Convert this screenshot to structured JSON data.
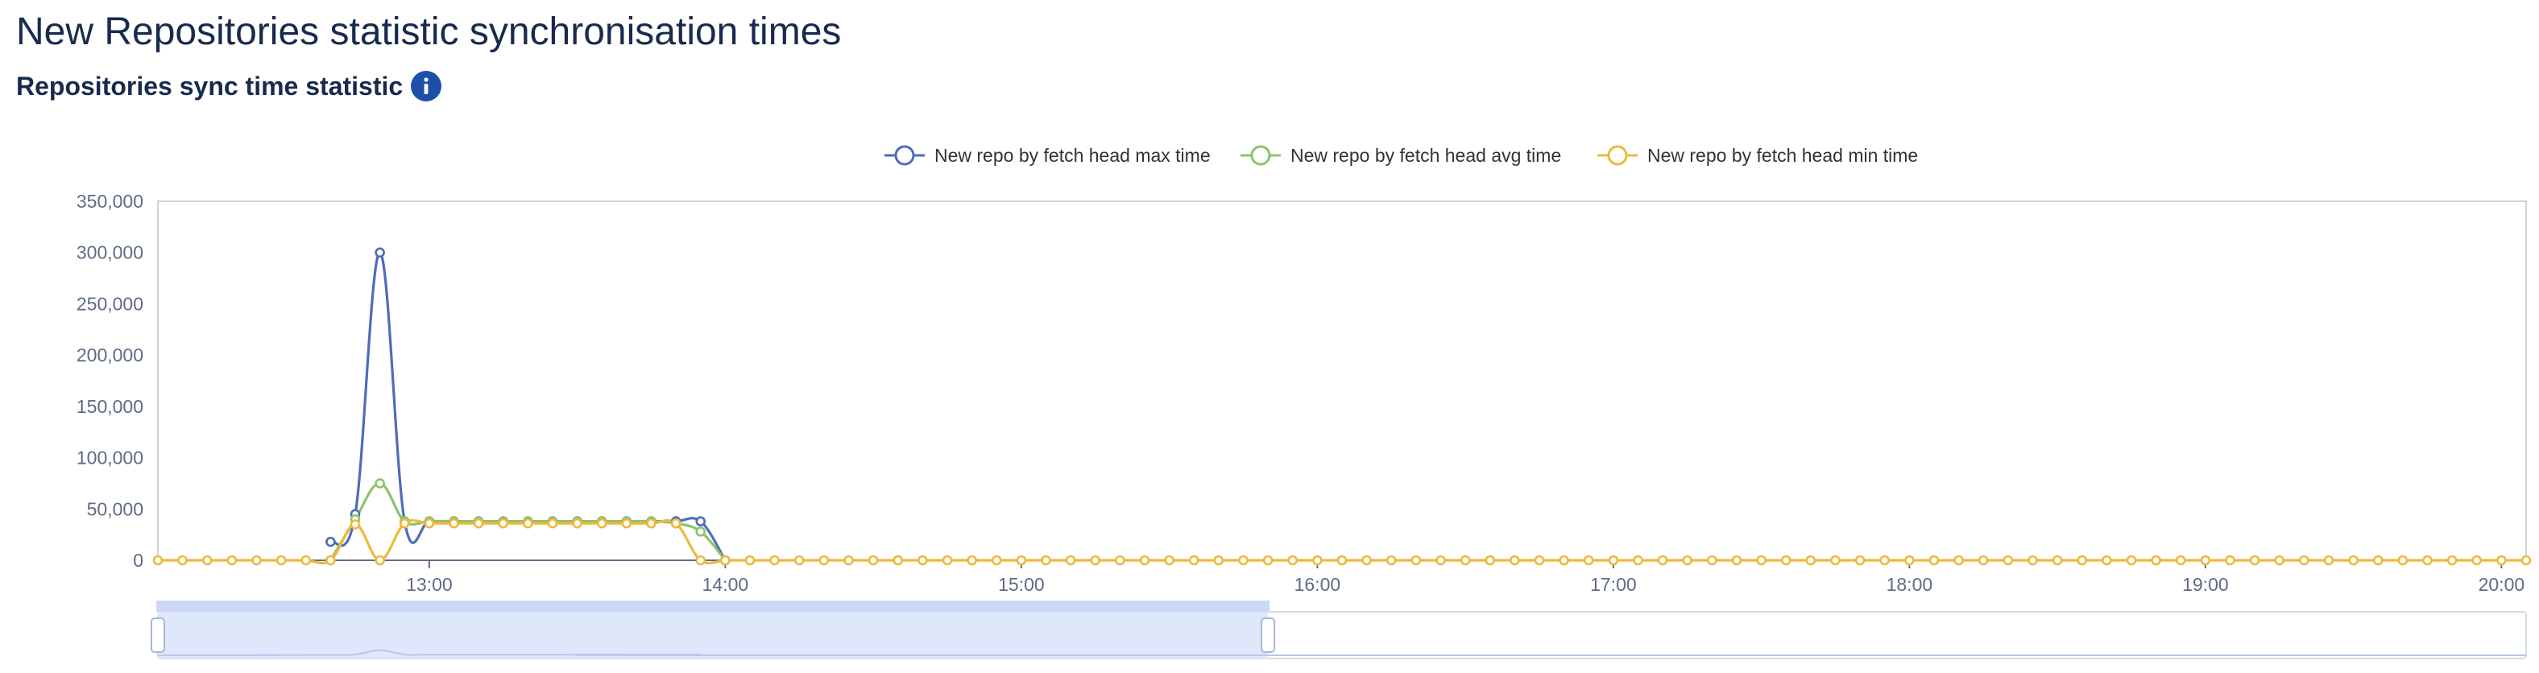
{
  "page": {
    "title": "New Repositories statistic synchronisation times",
    "subtitle": "Repositories sync time statistic"
  },
  "icons": {
    "info": "info-icon"
  },
  "colors": {
    "max": "#4e6cb9",
    "avg": "#8bc46a",
    "min": "#f0b83c",
    "title": "#172b4d",
    "info": "#1d4fa8",
    "zoom_fill": "#dfe7fb"
  },
  "chart_data": {
    "type": "line",
    "title": "",
    "xlabel": "",
    "ylabel": "",
    "legend_position": "top-center",
    "grid": false,
    "ylim": [
      0,
      350000
    ],
    "y_ticks": [
      0,
      50000,
      100000,
      150000,
      200000,
      250000,
      300000,
      350000
    ],
    "y_tick_labels": [
      "0",
      "50,000",
      "100,000",
      "150,000",
      "200,000",
      "250,000",
      "300,000",
      "350,000"
    ],
    "x_range": [
      "12:05",
      "20:05"
    ],
    "x_ticks": [
      "13:00",
      "14:00",
      "15:00",
      "16:00",
      "17:00",
      "18:00",
      "19:00",
      "20:00"
    ],
    "sample_interval_minutes": 5,
    "zoom_window": [
      "12:05",
      "15:50"
    ],
    "series": [
      {
        "name": "New repo by fetch head max time",
        "key": "max",
        "points": [
          [
            "12:40",
            18000
          ],
          [
            "12:45",
            45000
          ],
          [
            "12:50",
            300000
          ],
          [
            "12:55",
            38000
          ],
          [
            "13:00",
            38000
          ],
          [
            "13:05",
            38000
          ],
          [
            "13:10",
            38000
          ],
          [
            "13:15",
            38000
          ],
          [
            "13:20",
            38000
          ],
          [
            "13:25",
            38000
          ],
          [
            "13:30",
            38000
          ],
          [
            "13:35",
            38000
          ],
          [
            "13:40",
            38000
          ],
          [
            "13:45",
            38000
          ],
          [
            "13:50",
            38000
          ],
          [
            "13:55",
            38000
          ],
          [
            "14:00",
            0
          ]
        ]
      },
      {
        "name": "New repo by fetch head avg time",
        "key": "avg",
        "points": [
          [
            "12:40",
            0
          ],
          [
            "12:45",
            40000
          ],
          [
            "12:50",
            75000
          ],
          [
            "12:55",
            38000
          ],
          [
            "13:00",
            38000
          ],
          [
            "13:05",
            38000
          ],
          [
            "13:10",
            38000
          ],
          [
            "13:15",
            38000
          ],
          [
            "13:20",
            38000
          ],
          [
            "13:25",
            38000
          ],
          [
            "13:30",
            38000
          ],
          [
            "13:35",
            38000
          ],
          [
            "13:40",
            38000
          ],
          [
            "13:45",
            38000
          ],
          [
            "13:50",
            36000
          ],
          [
            "13:55",
            28000
          ],
          [
            "14:00",
            0
          ]
        ]
      },
      {
        "name": "New repo by fetch head min time",
        "key": "min",
        "points": [
          [
            "12:05",
            0
          ],
          [
            "12:10",
            0
          ],
          [
            "12:15",
            0
          ],
          [
            "12:20",
            0
          ],
          [
            "12:25",
            0
          ],
          [
            "12:30",
            0
          ],
          [
            "12:35",
            0
          ],
          [
            "12:40",
            0
          ],
          [
            "12:45",
            35000
          ],
          [
            "12:50",
            0
          ],
          [
            "12:55",
            36000
          ],
          [
            "13:00",
            36000
          ],
          [
            "13:05",
            36000
          ],
          [
            "13:10",
            36000
          ],
          [
            "13:15",
            36000
          ],
          [
            "13:20",
            36000
          ],
          [
            "13:25",
            36000
          ],
          [
            "13:30",
            36000
          ],
          [
            "13:35",
            36000
          ],
          [
            "13:40",
            36000
          ],
          [
            "13:45",
            36000
          ],
          [
            "13:50",
            36000
          ],
          [
            "13:55",
            0
          ],
          [
            "14:00",
            0
          ],
          [
            "14:05",
            0
          ],
          [
            "14:10",
            0
          ],
          [
            "14:15",
            0
          ],
          [
            "14:20",
            0
          ],
          [
            "14:25",
            0
          ],
          [
            "14:30",
            0
          ],
          [
            "14:35",
            0
          ],
          [
            "14:40",
            0
          ],
          [
            "14:45",
            0
          ],
          [
            "14:50",
            0
          ],
          [
            "14:55",
            0
          ],
          [
            "15:00",
            0
          ],
          [
            "15:05",
            0
          ],
          [
            "15:10",
            0
          ],
          [
            "15:15",
            0
          ],
          [
            "15:20",
            0
          ],
          [
            "15:25",
            0
          ],
          [
            "15:30",
            0
          ],
          [
            "15:35",
            0
          ],
          [
            "15:40",
            0
          ],
          [
            "15:45",
            0
          ],
          [
            "15:50",
            0
          ],
          [
            "15:55",
            0
          ],
          [
            "16:00",
            0
          ],
          [
            "16:05",
            0
          ],
          [
            "16:10",
            0
          ],
          [
            "16:15",
            0
          ],
          [
            "16:20",
            0
          ],
          [
            "16:25",
            0
          ],
          [
            "16:30",
            0
          ],
          [
            "16:35",
            0
          ],
          [
            "16:40",
            0
          ],
          [
            "16:45",
            0
          ],
          [
            "16:50",
            0
          ],
          [
            "16:55",
            0
          ],
          [
            "17:00",
            0
          ],
          [
            "17:05",
            0
          ],
          [
            "17:10",
            0
          ],
          [
            "17:15",
            0
          ],
          [
            "17:20",
            0
          ],
          [
            "17:25",
            0
          ],
          [
            "17:30",
            0
          ],
          [
            "17:35",
            0
          ],
          [
            "17:40",
            0
          ],
          [
            "17:45",
            0
          ],
          [
            "17:50",
            0
          ],
          [
            "17:55",
            0
          ],
          [
            "18:00",
            0
          ],
          [
            "18:05",
            0
          ],
          [
            "18:10",
            0
          ],
          [
            "18:15",
            0
          ],
          [
            "18:20",
            0
          ],
          [
            "18:25",
            0
          ],
          [
            "18:30",
            0
          ],
          [
            "18:35",
            0
          ],
          [
            "18:40",
            0
          ],
          [
            "18:45",
            0
          ],
          [
            "18:50",
            0
          ],
          [
            "18:55",
            0
          ],
          [
            "19:00",
            0
          ],
          [
            "19:05",
            0
          ],
          [
            "19:10",
            0
          ],
          [
            "19:15",
            0
          ],
          [
            "19:20",
            0
          ],
          [
            "19:25",
            0
          ],
          [
            "19:30",
            0
          ],
          [
            "19:35",
            0
          ],
          [
            "19:40",
            0
          ],
          [
            "19:45",
            0
          ],
          [
            "19:50",
            0
          ],
          [
            "19:55",
            0
          ],
          [
            "20:00",
            0
          ],
          [
            "20:05",
            0
          ]
        ]
      }
    ]
  }
}
